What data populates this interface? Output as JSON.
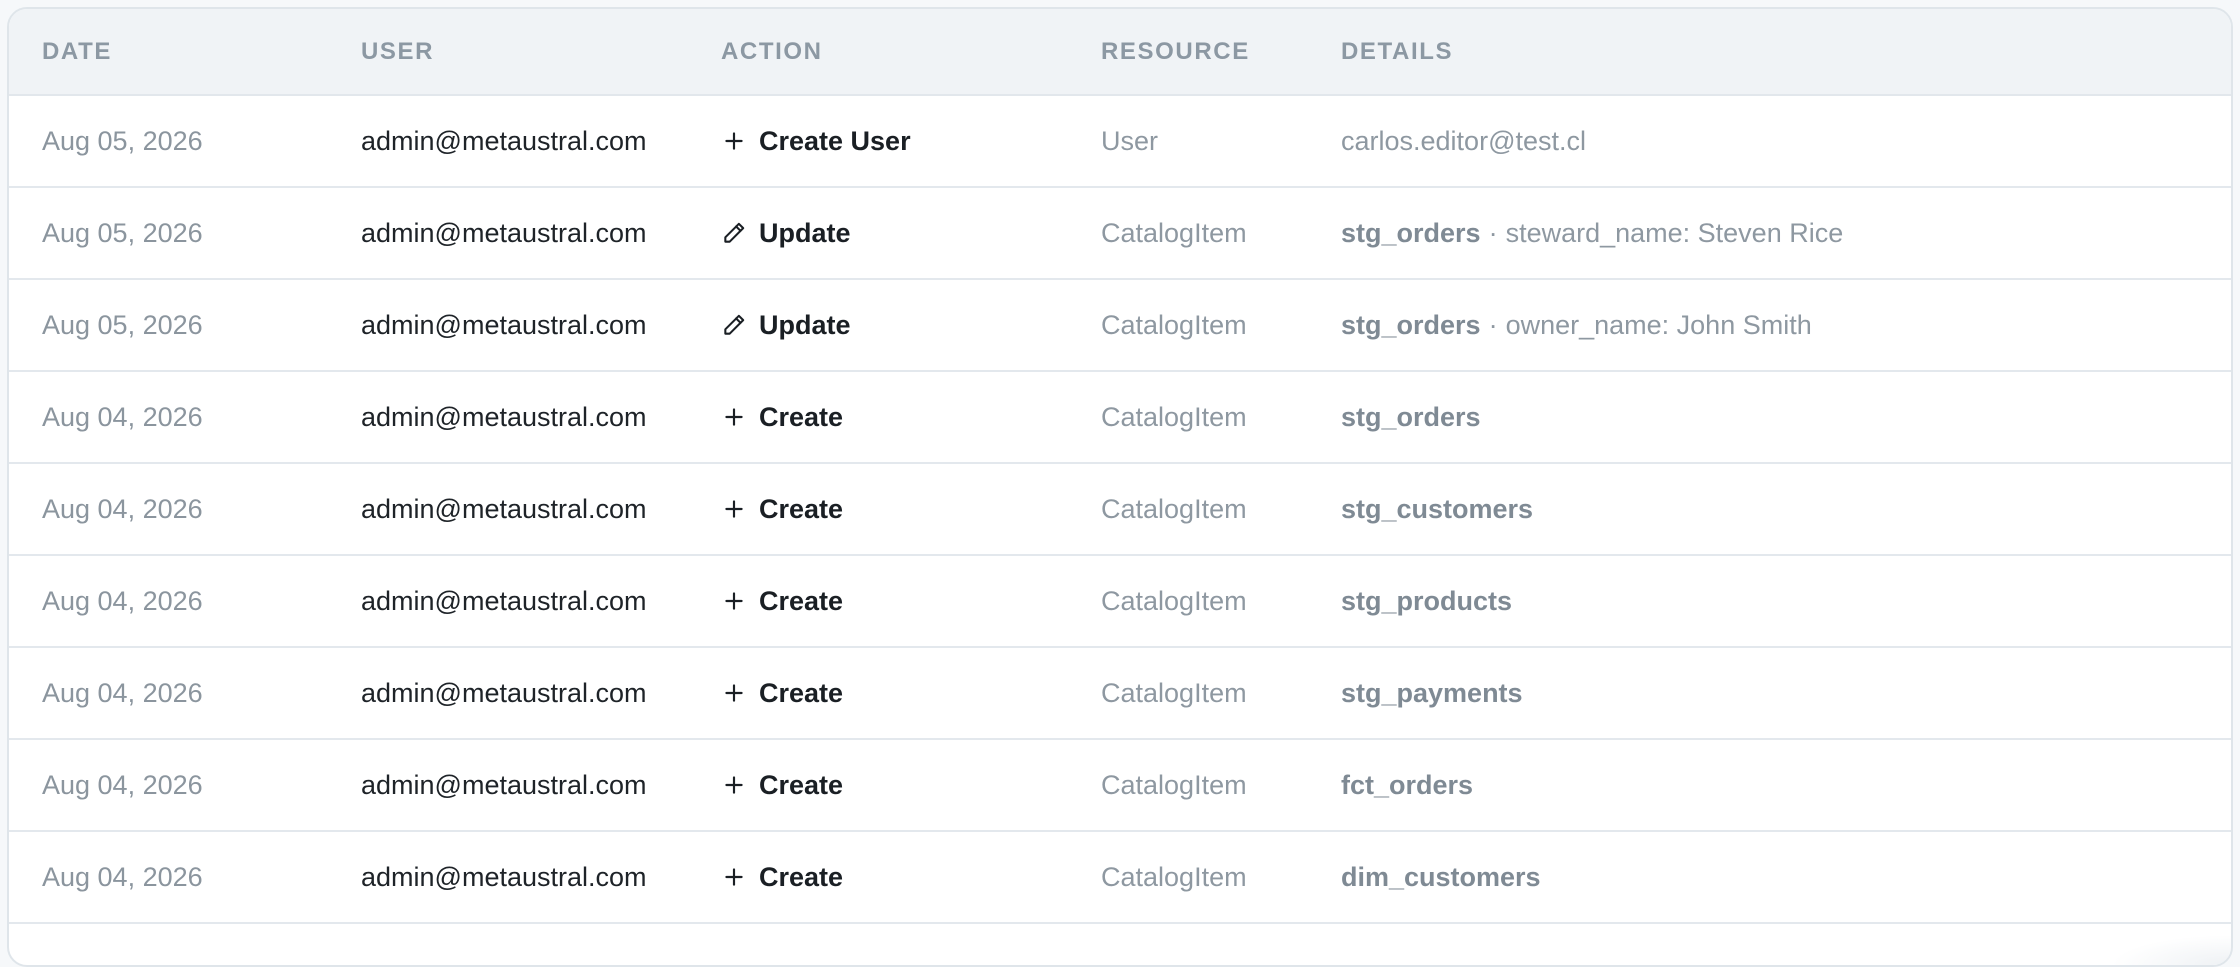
{
  "table": {
    "headers": {
      "date": "DATE",
      "user": "USER",
      "action": "ACTION",
      "resource": "RESOURCE",
      "details": "DETAILS"
    },
    "rows": [
      {
        "date": "Aug 05, 2026",
        "user": "admin@metaustral.com",
        "action_icon": "plus-icon",
        "action": "Create User",
        "resource": "User",
        "details_name": "",
        "details_sep": "",
        "details_extra": "carlos.editor@test.cl"
      },
      {
        "date": "Aug 05, 2026",
        "user": "admin@metaustral.com",
        "action_icon": "pencil-icon",
        "action": "Update",
        "resource": "CatalogItem",
        "details_name": "stg_orders",
        "details_sep": "·",
        "details_extra": "steward_name: Steven Rice"
      },
      {
        "date": "Aug 05, 2026",
        "user": "admin@metaustral.com",
        "action_icon": "pencil-icon",
        "action": "Update",
        "resource": "CatalogItem",
        "details_name": "stg_orders",
        "details_sep": "·",
        "details_extra": "owner_name: John Smith"
      },
      {
        "date": "Aug 04, 2026",
        "user": "admin@metaustral.com",
        "action_icon": "plus-icon",
        "action": "Create",
        "resource": "CatalogItem",
        "details_name": "stg_orders",
        "details_sep": "",
        "details_extra": ""
      },
      {
        "date": "Aug 04, 2026",
        "user": "admin@metaustral.com",
        "action_icon": "plus-icon",
        "action": "Create",
        "resource": "CatalogItem",
        "details_name": "stg_customers",
        "details_sep": "",
        "details_extra": ""
      },
      {
        "date": "Aug 04, 2026",
        "user": "admin@metaustral.com",
        "action_icon": "plus-icon",
        "action": "Create",
        "resource": "CatalogItem",
        "details_name": "stg_products",
        "details_sep": "",
        "details_extra": ""
      },
      {
        "date": "Aug 04, 2026",
        "user": "admin@metaustral.com",
        "action_icon": "plus-icon",
        "action": "Create",
        "resource": "CatalogItem",
        "details_name": "stg_payments",
        "details_sep": "",
        "details_extra": ""
      },
      {
        "date": "Aug 04, 2026",
        "user": "admin@metaustral.com",
        "action_icon": "plus-icon",
        "action": "Create",
        "resource": "CatalogItem",
        "details_name": "fct_orders",
        "details_sep": "",
        "details_extra": ""
      },
      {
        "date": "Aug 04, 2026",
        "user": "admin@metaustral.com",
        "action_icon": "plus-icon",
        "action": "Create",
        "resource": "CatalogItem",
        "details_name": "dim_customers",
        "details_sep": "",
        "details_extra": ""
      }
    ]
  },
  "colors": {
    "header_bg": "#f0f3f6",
    "border": "#e3e8ed",
    "muted_text": "#8b959e",
    "strong_text": "#1a1f24"
  }
}
